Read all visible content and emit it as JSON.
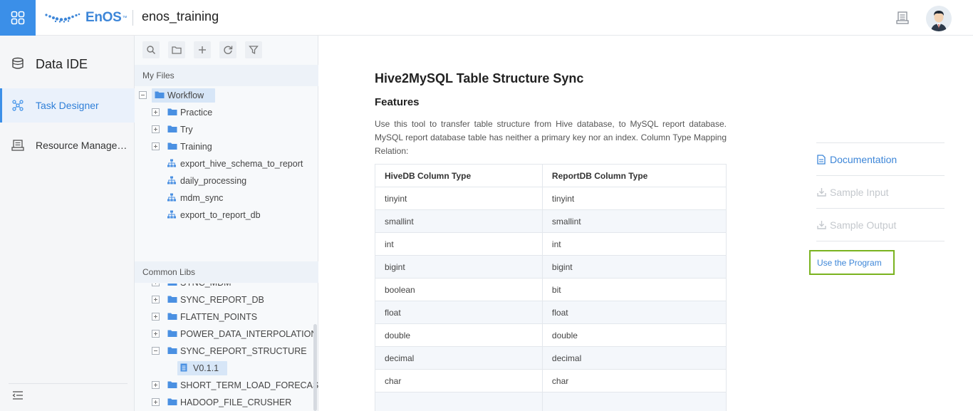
{
  "header": {
    "logo_text": "EnOS",
    "logo_tm": "™",
    "project_name": "enos_training"
  },
  "leftnav": {
    "title": "Data IDE",
    "items": [
      {
        "label": "Task Designer",
        "active": true
      },
      {
        "label": "Resource Management"
      }
    ]
  },
  "filepanel": {
    "my_files_label": "My Files",
    "common_libs_label": "Common Libs",
    "my_files": [
      {
        "label": "Workflow",
        "type": "folder",
        "expanded": true,
        "selected": true
      },
      {
        "label": "Practice",
        "type": "folder"
      },
      {
        "label": "Try",
        "type": "folder"
      },
      {
        "label": "Training",
        "type": "folder"
      },
      {
        "label": "export_hive_schema_to_report",
        "type": "flow"
      },
      {
        "label": "daily_processing",
        "type": "flow"
      },
      {
        "label": "mdm_sync",
        "type": "flow"
      },
      {
        "label": "export_to_report_db",
        "type": "flow"
      }
    ],
    "common_libs": [
      {
        "label": "SYNC_MDM",
        "type": "folder"
      },
      {
        "label": "SYNC_REPORT_DB",
        "type": "folder"
      },
      {
        "label": "FLATTEN_POINTS",
        "type": "folder"
      },
      {
        "label": "POWER_DATA_INTERPOLATION",
        "type": "folder"
      },
      {
        "label": "SYNC_REPORT_STRUCTURE",
        "type": "folder",
        "expanded": true
      },
      {
        "label": "V0.1.1",
        "type": "version",
        "selected": true
      },
      {
        "label": "SHORT_TERM_LOAD_FORECAST",
        "type": "folder"
      },
      {
        "label": "HADOOP_FILE_CRUSHER",
        "type": "folder"
      }
    ]
  },
  "main": {
    "title": "Hive2MySQL Table Structure Sync",
    "features_heading": "Features",
    "description": "Use this tool to transfer table structure from Hive database, to MySQL report database. MySQL report database table has neither a primary key nor an index. Column Type Mapping Relation:",
    "table": {
      "headers": [
        "HiveDB Column Type",
        "ReportDB Column Type"
      ],
      "rows": [
        [
          "tinyint",
          "tinyint"
        ],
        [
          "smallint",
          "smallint"
        ],
        [
          "int",
          "int"
        ],
        [
          "bigint",
          "bigint"
        ],
        [
          "boolean",
          "bit"
        ],
        [
          "float",
          "float"
        ],
        [
          "double",
          "double"
        ],
        [
          "decimal",
          "decimal"
        ],
        [
          "char",
          "char"
        ],
        [
          "",
          ""
        ]
      ]
    },
    "side_links": {
      "documentation": "Documentation",
      "sample_input": "Sample Input",
      "sample_output": "Sample Output"
    },
    "use_program": "Use the Program"
  },
  "colors": {
    "accent": "#3b8fe8",
    "link": "#3d86d8",
    "highlight_border": "#7ab31f",
    "disabled": "#c4c8cd"
  }
}
